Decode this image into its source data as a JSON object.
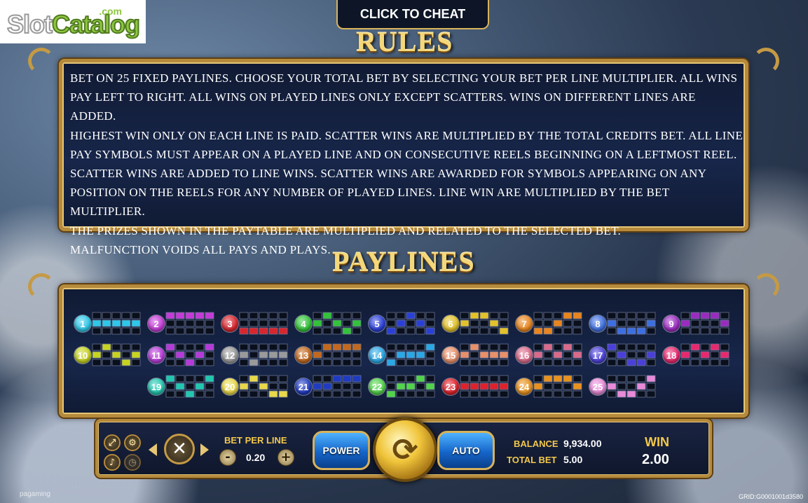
{
  "logo": {
    "part1": "Slot",
    "part2": "Catalog",
    "com": ".com"
  },
  "cheat_label": "CLICK TO CHEAT",
  "rules": {
    "title": "RULES",
    "lines": [
      "Bet on 25 fixed paylines. Choose your total bet by selecting your bet per line multiplier. All wins",
      "pay left to right. All wins on played lines only except scatters. Wins on different lines are added.",
      "Highest win only on each line is paid. Scatter wins are multiplied by the total credits bet. All line",
      "pay symbols must appear on a played line and on consecutive reels beginning on a leftmost reel.",
      "Scatter wins are added to line wins. Scatter wins are awarded for symbols appearing on any",
      "position on the reels for any number of played lines. Line win are multiplied by the bet multiplier.",
      "The prizes shown in the paytable are multiplied and related to the selected bet.",
      "Malfunction voids all pays and plays."
    ]
  },
  "paylines": {
    "title": "PAYLINES",
    "items": [
      {
        "n": "1",
        "color": "#2ec7e8",
        "rows": [
          1,
          1,
          1,
          1,
          1
        ]
      },
      {
        "n": "2",
        "color": "#c33bd6",
        "rows": [
          0,
          0,
          0,
          0,
          0
        ]
      },
      {
        "n": "3",
        "color": "#d8262e",
        "rows": [
          2,
          2,
          2,
          2,
          2
        ]
      },
      {
        "n": "4",
        "color": "#34c23a",
        "rows": [
          1,
          0,
          1,
          2,
          1
        ]
      },
      {
        "n": "5",
        "color": "#2a3fd8",
        "rows": [
          2,
          1,
          0,
          1,
          2
        ]
      },
      {
        "n": "6",
        "color": "#e3c12a",
        "rows": [
          1,
          0,
          0,
          1,
          2
        ]
      },
      {
        "n": "7",
        "color": "#e8851e",
        "rows": [
          2,
          2,
          1,
          0,
          0
        ]
      },
      {
        "n": "8",
        "color": "#3e6fe0",
        "rows": [
          1,
          2,
          2,
          2,
          1
        ]
      },
      {
        "n": "9",
        "color": "#9b2bc0",
        "rows": [
          1,
          0,
          0,
          0,
          1
        ]
      },
      {
        "n": "10",
        "color": "#c7d321",
        "rows": [
          1,
          0,
          1,
          2,
          1
        ]
      },
      {
        "n": "11",
        "color": "#b63ad8",
        "rows": [
          0,
          1,
          2,
          1,
          0
        ]
      },
      {
        "n": "12",
        "color": "#9a9a9a",
        "rows": [
          1,
          2,
          1,
          1,
          1
        ]
      },
      {
        "n": "13",
        "color": "#c2691e",
        "rows": [
          1,
          0,
          0,
          0,
          0
        ]
      },
      {
        "n": "14",
        "color": "#2aa8e6",
        "rows": [
          2,
          1,
          1,
          1,
          0
        ]
      },
      {
        "n": "15",
        "color": "#e8906a",
        "rows": [
          1,
          0,
          1,
          1,
          1
        ]
      },
      {
        "n": "16",
        "color": "#d96a8a",
        "rows": [
          1,
          0,
          1,
          0,
          1
        ]
      },
      {
        "n": "17",
        "color": "#4a3fd8",
        "rows": [
          0,
          1,
          2,
          2,
          1
        ]
      },
      {
        "n": "18",
        "color": "#e8286e",
        "rows": [
          1,
          0,
          1,
          0,
          1
        ]
      },
      {
        "n": "19",
        "color": "#22c7b0",
        "rows": [
          0,
          1,
          2,
          1,
          0
        ]
      },
      {
        "n": "20",
        "color": "#e8d84a",
        "rows": [
          1,
          0,
          1,
          2,
          2
        ]
      },
      {
        "n": "21",
        "color": "#1f3bc0",
        "rows": [
          1,
          1,
          0,
          0,
          0
        ]
      },
      {
        "n": "22",
        "color": "#52d44a",
        "rows": [
          2,
          1,
          1,
          0,
          1
        ]
      },
      {
        "n": "23",
        "color": "#e0202a",
        "rows": [
          1,
          1,
          1,
          1,
          1
        ]
      },
      {
        "n": "24",
        "color": "#e8921e",
        "rows": [
          1,
          0,
          0,
          0,
          1
        ]
      },
      {
        "n": "25",
        "color": "#e88ad8",
        "rows": [
          1,
          2,
          2,
          1,
          0
        ]
      }
    ]
  },
  "controls": {
    "bet_per_line_label": "BET PER LINE",
    "bet_per_line_value": "0.20",
    "minus": "-",
    "plus": "+",
    "power_label": "POWER",
    "auto_label": "AUTO",
    "balance_label": "BALANCE",
    "balance_value": "9,934.00",
    "total_bet_label": "TOTAL BET",
    "total_bet_value": "5.00",
    "win_label": "WIN",
    "win_value": "2.00"
  },
  "footer": {
    "brand": "pagaming",
    "grid": "GRID:G0001001d3580"
  }
}
